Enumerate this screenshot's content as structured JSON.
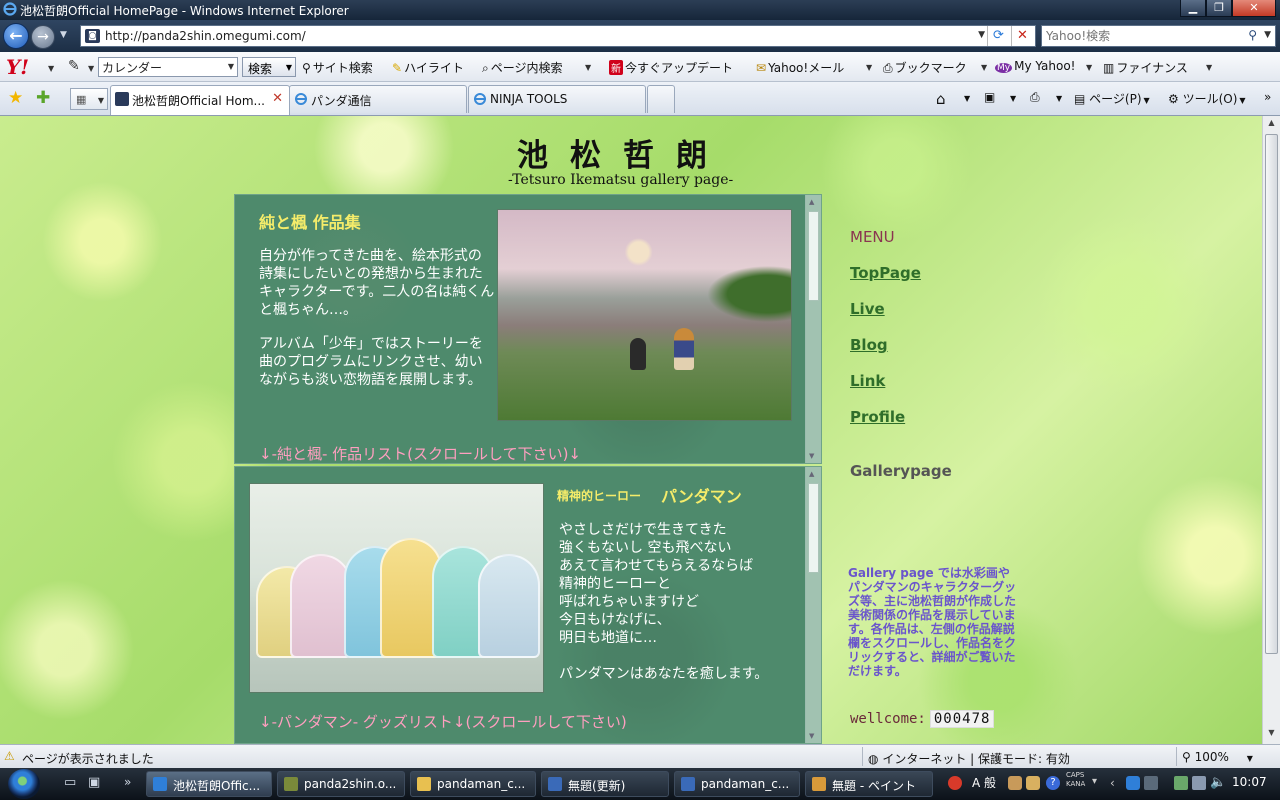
{
  "window": {
    "title": "池松哲朗Official HomePage - Windows Internet Explorer"
  },
  "address_bar": {
    "url": "http://panda2shin.omegumi.com/",
    "search_placeholder": "Yahoo!検索"
  },
  "yahoo_toolbar": {
    "search_value": "カレンダー",
    "search_button": "検索",
    "items": [
      "サイト検索",
      "ハイライト",
      "ページ内検索",
      "今すぐアップデート",
      "Yahoo!メール",
      "ブックマーク",
      "My Yahoo!",
      "ファイナンス"
    ]
  },
  "tabs": [
    {
      "label": "池松哲朗Official Hom...",
      "active": true
    },
    {
      "label": "パンダ通信",
      "active": false
    },
    {
      "label": "NINJA TOOLS",
      "active": false
    }
  ],
  "command_bar": {
    "page": "ページ(P)",
    "tools": "ツール(O)"
  },
  "page": {
    "title": "池松哲朗",
    "subtitle": "-Tetsuro Ikematsu gallery page-",
    "panel1": {
      "heading": "純と楓 作品集",
      "para1": "自分が作ってきた曲を、絵本形式の詩集にしたいとの発想から生まれたキャラクターです。二人の名は純くんと楓ちゃん…。",
      "para2": "アルバム「少年」ではストーリーを曲のプログラムにリンクさせ、幼いながらも淡い恋物語を展開します。",
      "footer": "↓-純と楓- 作品リスト(スクロールして下さい)↓"
    },
    "panel2": {
      "heading_small": "精神的ヒーロー",
      "heading_big": "パンダマン",
      "poem": [
        "やさしさだけで生きてきた",
        "強くもないし 空も飛べない",
        "あえて言わせてもらえるならば",
        "精神的ヒーローと",
        "呼ばれちゃいますけど",
        "今日もけなげに、",
        "明日も地道に…"
      ],
      "closing": "パンダマンはあなたを癒します。",
      "footer": "↓-パンダマン- グッズリスト↓(スクロールして下さい)"
    },
    "menu": {
      "title": "MENU",
      "links": [
        "TopPage",
        "Live",
        "Blog",
        "Link",
        "Profile"
      ],
      "current": "Gallerypage"
    },
    "description": "Gallery page では水彩画やパンダマンのキャラクターグッズ等、主に池松哲朗が作成した美術関係の作品を展示しています。各作品は、左側の作品解説欄をスクロールし、作品名をクリックすると、詳細がご覧いただけます。",
    "counter_label": "wellcome:",
    "counter_value": "000478"
  },
  "status_bar": {
    "message": "ページが表示されました",
    "zone": "インターネット | 保護モード: 有効",
    "zoom": "100%"
  },
  "taskbar": {
    "tasks": [
      {
        "label": "池松哲朗Offic...",
        "active": true
      },
      {
        "label": "panda2shin.o...",
        "active": false
      },
      {
        "label": "pandaman_c...",
        "active": false
      },
      {
        "label": "無題(更新)",
        "active": false
      },
      {
        "label": "pandaman_c...",
        "active": false
      },
      {
        "label": "無題 - ペイント",
        "active": false
      }
    ],
    "ime": "A 般",
    "caps": "CAPS",
    "kana": "KANA",
    "clock": "10:07"
  },
  "colors": {
    "panel_green": "#4e8a6c",
    "heading_yellow": "#f5ec6a",
    "footer_pink": "#ff9fc0",
    "desc_purple": "#6a55cc",
    "menu_green": "#2f6e2a"
  }
}
